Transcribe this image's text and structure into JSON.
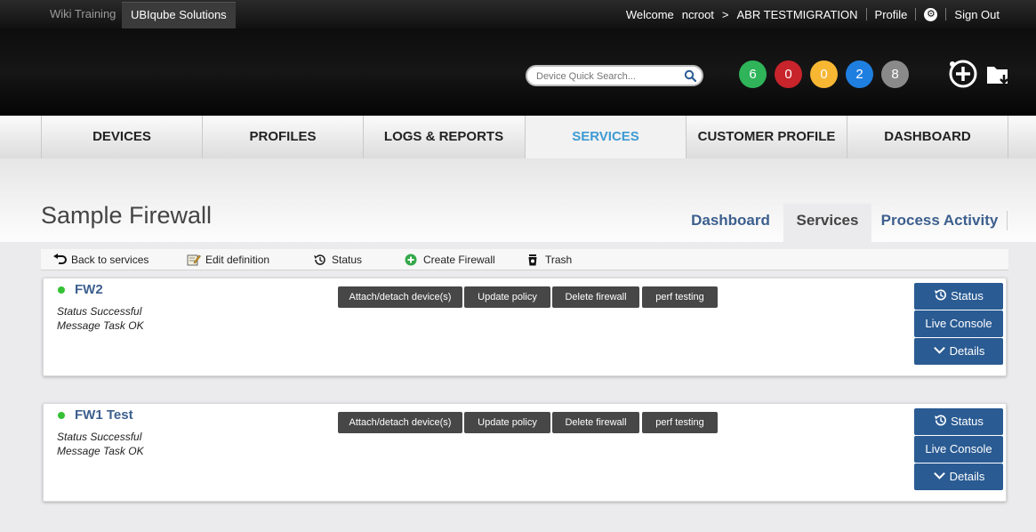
{
  "topbar": {
    "tabs": [
      "Wiki Training",
      "UBIqube Solutions"
    ],
    "welcome": "Welcome",
    "user": "ncroot",
    "arrow": ">",
    "customer": "ABR TESTMIGRATION",
    "profile": "Profile",
    "sign_out": "Sign Out"
  },
  "header": {
    "search_placeholder": "Device Quick Search...",
    "badges": [
      {
        "value": "6",
        "color": "#2fb45a"
      },
      {
        "value": "0",
        "color": "#c8242b"
      },
      {
        "value": "0",
        "color": "#f7b733"
      },
      {
        "value": "2",
        "color": "#1f7fe0"
      },
      {
        "value": "8",
        "color": "#8a8a8a"
      }
    ]
  },
  "nav": {
    "items": [
      "DEVICES",
      "PROFILES",
      "LOGS & REPORTS",
      "SERVICES",
      "CUSTOMER PROFILE",
      "DASHBOARD"
    ],
    "active": "SERVICES",
    "active_color": "#3e9ad3"
  },
  "page": {
    "title": "Sample Firewall",
    "subtabs": [
      "Dashboard",
      "Services",
      "Process Activity"
    ],
    "active_subtab": "Services"
  },
  "toolbar": {
    "back": "Back to services",
    "edit": "Edit definition",
    "status": "Status",
    "create": "Create Firewall",
    "trash": "Trash"
  },
  "services": [
    {
      "name": "FW2",
      "status": "Status Successful",
      "message": "Message Task OK",
      "actions": [
        "Attach/detach device(s)",
        "Update policy",
        "Delete firewall",
        "perf testing"
      ],
      "side": [
        "Status",
        "Live Console",
        "Details"
      ]
    },
    {
      "name": "FW1 Test",
      "status": "Status Successful",
      "message": "Message Task OK",
      "actions": [
        "Attach/detach device(s)",
        "Update policy",
        "Delete firewall",
        "perf testing"
      ],
      "side": [
        "Status",
        "Live Console",
        "Details"
      ]
    }
  ]
}
